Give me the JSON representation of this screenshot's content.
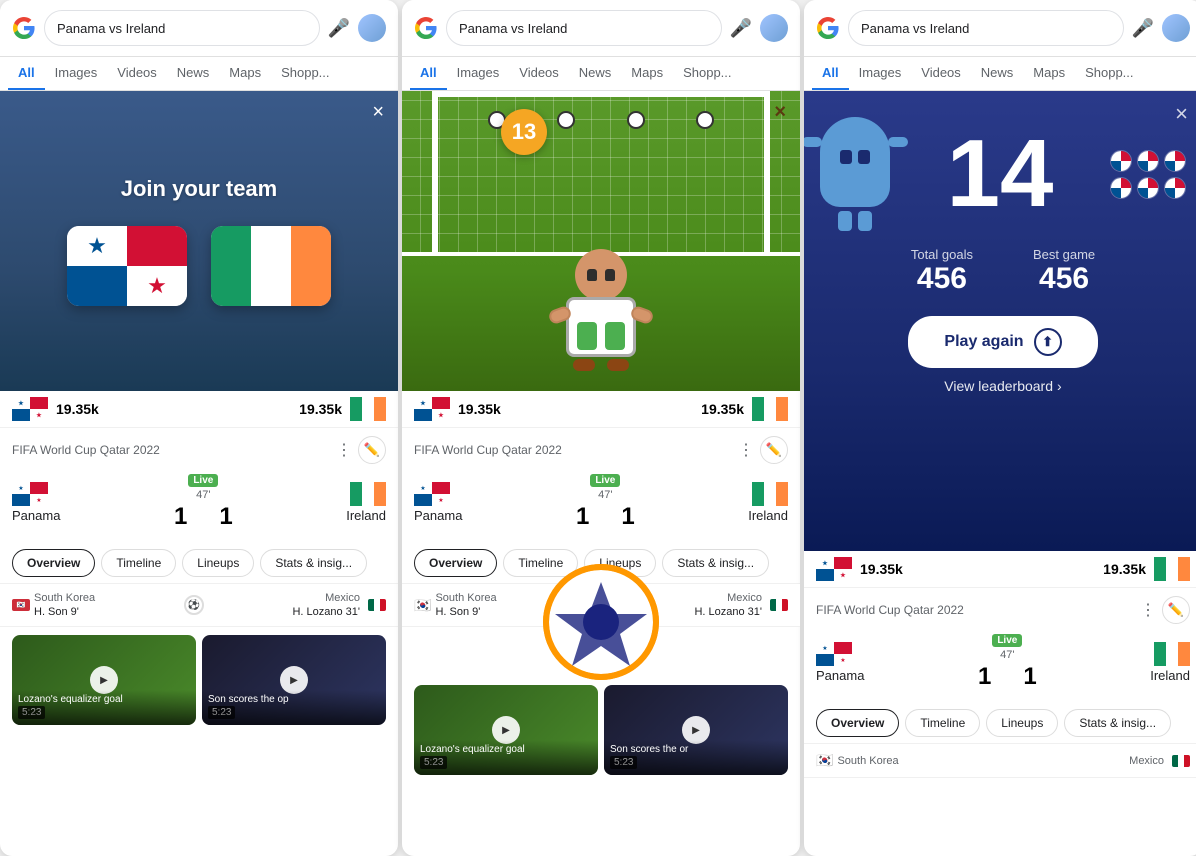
{
  "panels": [
    {
      "id": "panel1",
      "search": {
        "query": "Panama vs Ireland",
        "mic_label": "microphone",
        "avatar_label": "user avatar"
      },
      "nav_tabs": [
        "All",
        "Images",
        "Videos",
        "News",
        "Maps",
        "Shopp..."
      ],
      "active_tab": "All",
      "game": {
        "type": "join_team",
        "title": "Join your team",
        "close_label": "×",
        "team1": "Panama",
        "team2": "Ireland"
      },
      "score_bar": {
        "left_score": "19.35k",
        "right_score": "19.35k"
      },
      "match": {
        "tournament": "FIFA World Cup Qatar 2022",
        "team1": "Panama",
        "score1": "1",
        "live": "Live",
        "time": "47'",
        "score2": "1",
        "team2": "Ireland"
      },
      "tabs": [
        "Overview",
        "Timeline",
        "Lineups",
        "Stats & insig..."
      ],
      "goals": {
        "left_country": "South Korea",
        "left_player": "H. Son 9'",
        "right_country": "Mexico",
        "right_player": "H. Lozano 31'"
      },
      "videos": [
        {
          "time": "5:23",
          "caption": "Lozano's equalizer goal"
        },
        {
          "time": "5:23",
          "caption": "Son scores the op"
        }
      ]
    },
    {
      "id": "panel2",
      "search": {
        "query": "Panama vs Ireland"
      },
      "nav_tabs": [
        "All",
        "Images",
        "Videos",
        "News",
        "Maps",
        "Shopp..."
      ],
      "active_tab": "All",
      "game": {
        "type": "goalkeeper",
        "score": "13",
        "close_label": "×"
      },
      "score_bar": {
        "left_score": "19.35k",
        "right_score": "19.35k"
      },
      "match": {
        "tournament": "FIFA World Cup Qatar 2022",
        "team1": "Panama",
        "score1": "1",
        "live": "Live",
        "time": "47'",
        "score2": "1",
        "team2": "Ireland"
      },
      "tabs": [
        "Overview",
        "Timeline",
        "Lineups",
        "Stats & insig..."
      ],
      "goals": {
        "left_country": "South Korea",
        "left_player": "H. Son 9'",
        "right_country": "Mexico",
        "right_player": "H. Lozano 31'"
      },
      "soccer_ball_overlay": true,
      "videos": [
        {
          "time": "5:23",
          "caption": "Lozano's equalizer goal"
        },
        {
          "time": "5:23",
          "caption": "Son scores the or"
        }
      ]
    },
    {
      "id": "panel3",
      "search": {
        "query": "Panama vs Ireland"
      },
      "nav_tabs": [
        "All",
        "Images",
        "Videos",
        "News",
        "Maps",
        "Shopp..."
      ],
      "active_tab": "All",
      "game": {
        "type": "results",
        "big_number": "14",
        "close_label": "×",
        "total_goals_label": "Total goals",
        "total_goals_value": "456",
        "best_game_label": "Best game",
        "best_game_value": "456",
        "play_again_label": "Play again",
        "view_leaderboard_label": "View leaderboard"
      },
      "score_bar": {
        "left_score": "19.35k",
        "right_score": "19.35k"
      },
      "match": {
        "tournament": "FIFA World Cup Qatar 2022",
        "team1": "Panama",
        "score1": "1",
        "live": "Live",
        "time": "47'",
        "score2": "1",
        "team2": "Ireland"
      },
      "tabs": [
        "Overview",
        "Timeline",
        "Lineups",
        "Stats & insig..."
      ],
      "goals": {
        "left_country": "South Korea",
        "right_country": "Mexico"
      }
    }
  ]
}
